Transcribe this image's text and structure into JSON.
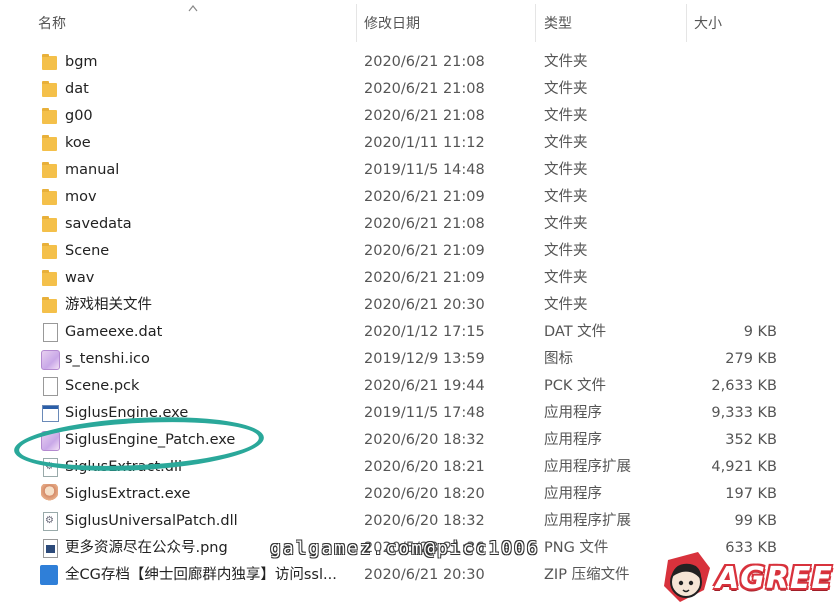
{
  "columns": {
    "name": "名称",
    "date": "修改日期",
    "type": "类型",
    "size": "大小"
  },
  "files": [
    {
      "name": "bgm",
      "date": "2020/6/21 21:08",
      "type": "文件夹",
      "size": "",
      "icon": "folder-icon"
    },
    {
      "name": "dat",
      "date": "2020/6/21 21:08",
      "type": "文件夹",
      "size": "",
      "icon": "folder-icon"
    },
    {
      "name": "g00",
      "date": "2020/6/21 21:08",
      "type": "文件夹",
      "size": "",
      "icon": "folder-icon"
    },
    {
      "name": "koe",
      "date": "2020/1/11 11:12",
      "type": "文件夹",
      "size": "",
      "icon": "folder-icon"
    },
    {
      "name": "manual",
      "date": "2019/11/5 14:48",
      "type": "文件夹",
      "size": "",
      "icon": "folder-icon"
    },
    {
      "name": "mov",
      "date": "2020/6/21 21:09",
      "type": "文件夹",
      "size": "",
      "icon": "folder-icon"
    },
    {
      "name": "savedata",
      "date": "2020/6/21 21:08",
      "type": "文件夹",
      "size": "",
      "icon": "folder-icon"
    },
    {
      "name": "Scene",
      "date": "2020/6/21 21:09",
      "type": "文件夹",
      "size": "",
      "icon": "folder-icon"
    },
    {
      "name": "wav",
      "date": "2020/6/21 21:09",
      "type": "文件夹",
      "size": "",
      "icon": "folder-icon"
    },
    {
      "name": "游戏相关文件",
      "date": "2020/6/21 20:30",
      "type": "文件夹",
      "size": "",
      "icon": "folder-icon"
    },
    {
      "name": "Gameexe.dat",
      "date": "2020/1/12 17:15",
      "type": "DAT 文件",
      "size": "9 KB",
      "icon": "document-icon"
    },
    {
      "name": "s_tenshi.ico",
      "date": "2019/12/9 13:59",
      "type": "图标",
      "size": "279 KB",
      "icon": "image-icon"
    },
    {
      "name": "Scene.pck",
      "date": "2020/6/21 19:44",
      "type": "PCK 文件",
      "size": "2,633 KB",
      "icon": "document-icon"
    },
    {
      "name": "SiglusEngine.exe",
      "date": "2019/11/5 17:48",
      "type": "应用程序",
      "size": "9,333 KB",
      "icon": "application-icon"
    },
    {
      "name": "SiglusEngine_Patch.exe",
      "date": "2020/6/20 18:32",
      "type": "应用程序",
      "size": "352 KB",
      "icon": "image-icon"
    },
    {
      "name": "SiglusExtract.dll",
      "date": "2020/6/20 18:21",
      "type": "应用程序扩展",
      "size": "4,921 KB",
      "icon": "dll-icon"
    },
    {
      "name": "SiglusExtract.exe",
      "date": "2020/6/20 18:20",
      "type": "应用程序",
      "size": "197 KB",
      "icon": "character-icon"
    },
    {
      "name": "SiglusUniversalPatch.dll",
      "date": "2020/6/20 18:32",
      "type": "应用程序扩展",
      "size": "99 KB",
      "icon": "dll-icon"
    },
    {
      "name": "更多资源尽在公众号.png",
      "date": "2020/5/28 21:36",
      "type": "PNG 文件",
      "size": "633 KB",
      "icon": "png-icon"
    },
    {
      "name": "全CG存档【绅士回廊群内独享】访问ssl...",
      "date": "2020/6/21 20:30",
      "type": "ZIP 压缩文件",
      "size": "",
      "icon": "zip-icon"
    }
  ],
  "overlay": {
    "watermark": "galgamez.com@picc1006",
    "logo_text": "AGREE",
    "highlight_color": "#2aa89a"
  }
}
